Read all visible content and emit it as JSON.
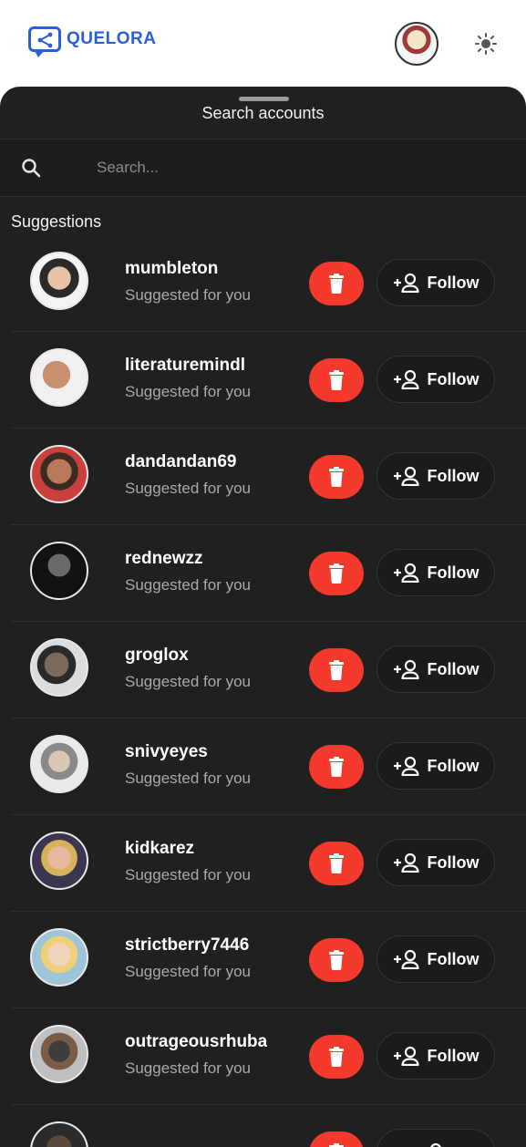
{
  "header": {
    "brand": "QUELORA",
    "brand_color": "#2b5fd9",
    "avatar_icon": "user-avatar",
    "theme_icon": "sun-icon"
  },
  "sheet": {
    "title": "Search accounts",
    "search": {
      "placeholder": "Search...",
      "value": "",
      "icon": "search-icon"
    },
    "section_label": "Suggestions",
    "delete_color": "#f33a2d",
    "suggestions": [
      {
        "username": "mumbleton",
        "subtitle": "Suggested for you",
        "follow_label": "Follow"
      },
      {
        "username": "literaturemindl",
        "subtitle": "Suggested for you",
        "follow_label": "Follow"
      },
      {
        "username": "dandandan69",
        "subtitle": "Suggested for you",
        "follow_label": "Follow"
      },
      {
        "username": "rednewzz",
        "subtitle": "Suggested for you",
        "follow_label": "Follow"
      },
      {
        "username": "groglox",
        "subtitle": "Suggested for you",
        "follow_label": "Follow"
      },
      {
        "username": "snivyeyes",
        "subtitle": "Suggested for you",
        "follow_label": "Follow"
      },
      {
        "username": "kidkarez",
        "subtitle": "Suggested for you",
        "follow_label": "Follow"
      },
      {
        "username": "strictberry7446",
        "subtitle": "Suggested for you",
        "follow_label": "Follow"
      },
      {
        "username": "outrageousrhuba",
        "subtitle": "Suggested for you",
        "follow_label": "Follow"
      },
      {
        "username": "",
        "subtitle": "",
        "follow_label": ""
      }
    ]
  }
}
